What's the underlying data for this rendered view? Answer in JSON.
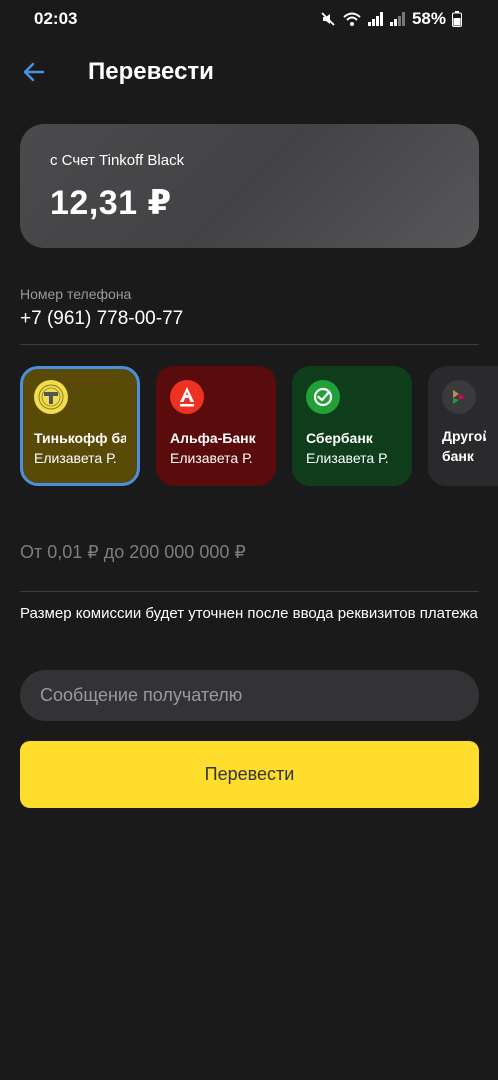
{
  "status_bar": {
    "time": "02:03",
    "battery": "58%"
  },
  "header": {
    "title": "Перевести"
  },
  "account": {
    "label": "с Счет Tinkoff Black",
    "balance": "12,31 ₽"
  },
  "phone": {
    "label": "Номер телефона",
    "value": "+7 (961) 778-00-77"
  },
  "banks": [
    {
      "name": "Тинькофф банк",
      "holder": "Елизавета Р.",
      "bg": "#5a4a08",
      "logo_bg": "#f2dc4a",
      "selected": true
    },
    {
      "name": "Альфа-Банк",
      "holder": "Елизавета Р.",
      "bg": "#5a0c0c",
      "logo_bg": "#ef3124"
    },
    {
      "name": "Сбербанк",
      "holder": "Елизавета Р.",
      "bg": "#0f3d1c",
      "logo_bg": "#21a038"
    },
    {
      "name": "Другой банк",
      "bg": "#2a2a2c",
      "logo_bg": "#3a3a3d"
    }
  ],
  "limits": {
    "text": "От 0,01 ₽ до 200 000 000 ₽"
  },
  "commission": {
    "text": "Размер комиссии будет уточнен после ввода реквизитов платежа"
  },
  "message": {
    "placeholder": "Сообщение получателю",
    "value": ""
  },
  "actions": {
    "transfer_label": "Перевести"
  },
  "colors": {
    "accent": "#ffdd2d",
    "selected_border": "#4a8fe0",
    "back_arrow": "#4a8fe0",
    "background": "#1a1a1a"
  }
}
